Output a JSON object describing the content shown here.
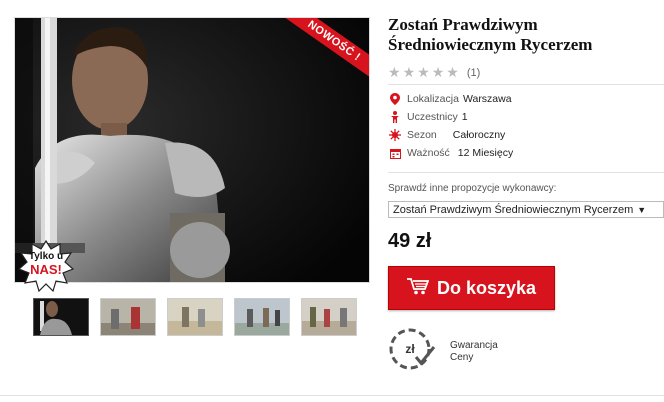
{
  "product": {
    "title_line1": "Zostań Prawdziwym",
    "title_line2": "Średniowiecznym Rycerzem",
    "badge_new": "NOWOŚĆ !",
    "badge_exclusive_line1": "Tylko u",
    "badge_exclusive_line2": "NAS!",
    "rating": {
      "stars": 5,
      "filled": 0,
      "count_label": "(1)",
      "star_color": "#bbbbbb"
    },
    "attributes": [
      {
        "icon": "location-pin-icon",
        "label": "Lokalizacja",
        "value": "Warszawa"
      },
      {
        "icon": "person-icon",
        "label": "Uczestnicy",
        "value": "1"
      },
      {
        "icon": "sun-icon",
        "label": "Sezon",
        "value": "Całoroczny"
      },
      {
        "icon": "calendar-icon",
        "label": "Ważność",
        "value": "12 Miesięcy"
      }
    ],
    "providers_label": "Sprawdź inne propozycje wykonawcy:",
    "provider_selected": "Zostań Prawdziwym Średniowiecznym Rycerzem",
    "price": "49 zł",
    "cart_button": "Do koszyka",
    "guarantee_line1": "Gwarancja",
    "guarantee_line2": "Ceny",
    "accent_color": "#d7141d",
    "thumbnail_count": 5
  }
}
